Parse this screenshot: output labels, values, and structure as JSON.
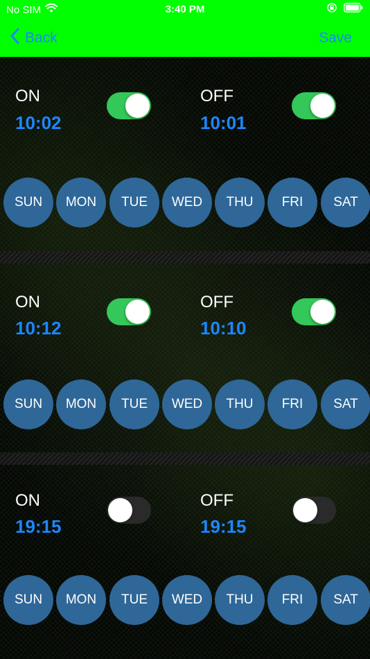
{
  "status_bar": {
    "carrier": "No SIM",
    "time": "3:40 PM"
  },
  "nav": {
    "back_label": "Back",
    "save_label": "Save"
  },
  "colors": {
    "nav_bg": "#00ff00",
    "accent_blue": "#1c87ff",
    "toggle_on": "#34c759",
    "day_bg": "#2f6798"
  },
  "schedules": [
    {
      "on_label": "ON",
      "on_time": "10:02",
      "on_enabled": true,
      "off_label": "OFF",
      "off_time": "10:01",
      "off_enabled": true,
      "days": [
        "SUN",
        "MON",
        "TUE",
        "WED",
        "THU",
        "FRI",
        "SAT"
      ]
    },
    {
      "on_label": "ON",
      "on_time": "10:12",
      "on_enabled": true,
      "off_label": "OFF",
      "off_time": "10:10",
      "off_enabled": true,
      "days": [
        "SUN",
        "MON",
        "TUE",
        "WED",
        "THU",
        "FRI",
        "SAT"
      ]
    },
    {
      "on_label": "ON",
      "on_time": "19:15",
      "on_enabled": false,
      "off_label": "OFF",
      "off_time": "19:15",
      "off_enabled": false,
      "days": [
        "SUN",
        "MON",
        "TUE",
        "WED",
        "THU",
        "FRI",
        "SAT"
      ]
    }
  ]
}
